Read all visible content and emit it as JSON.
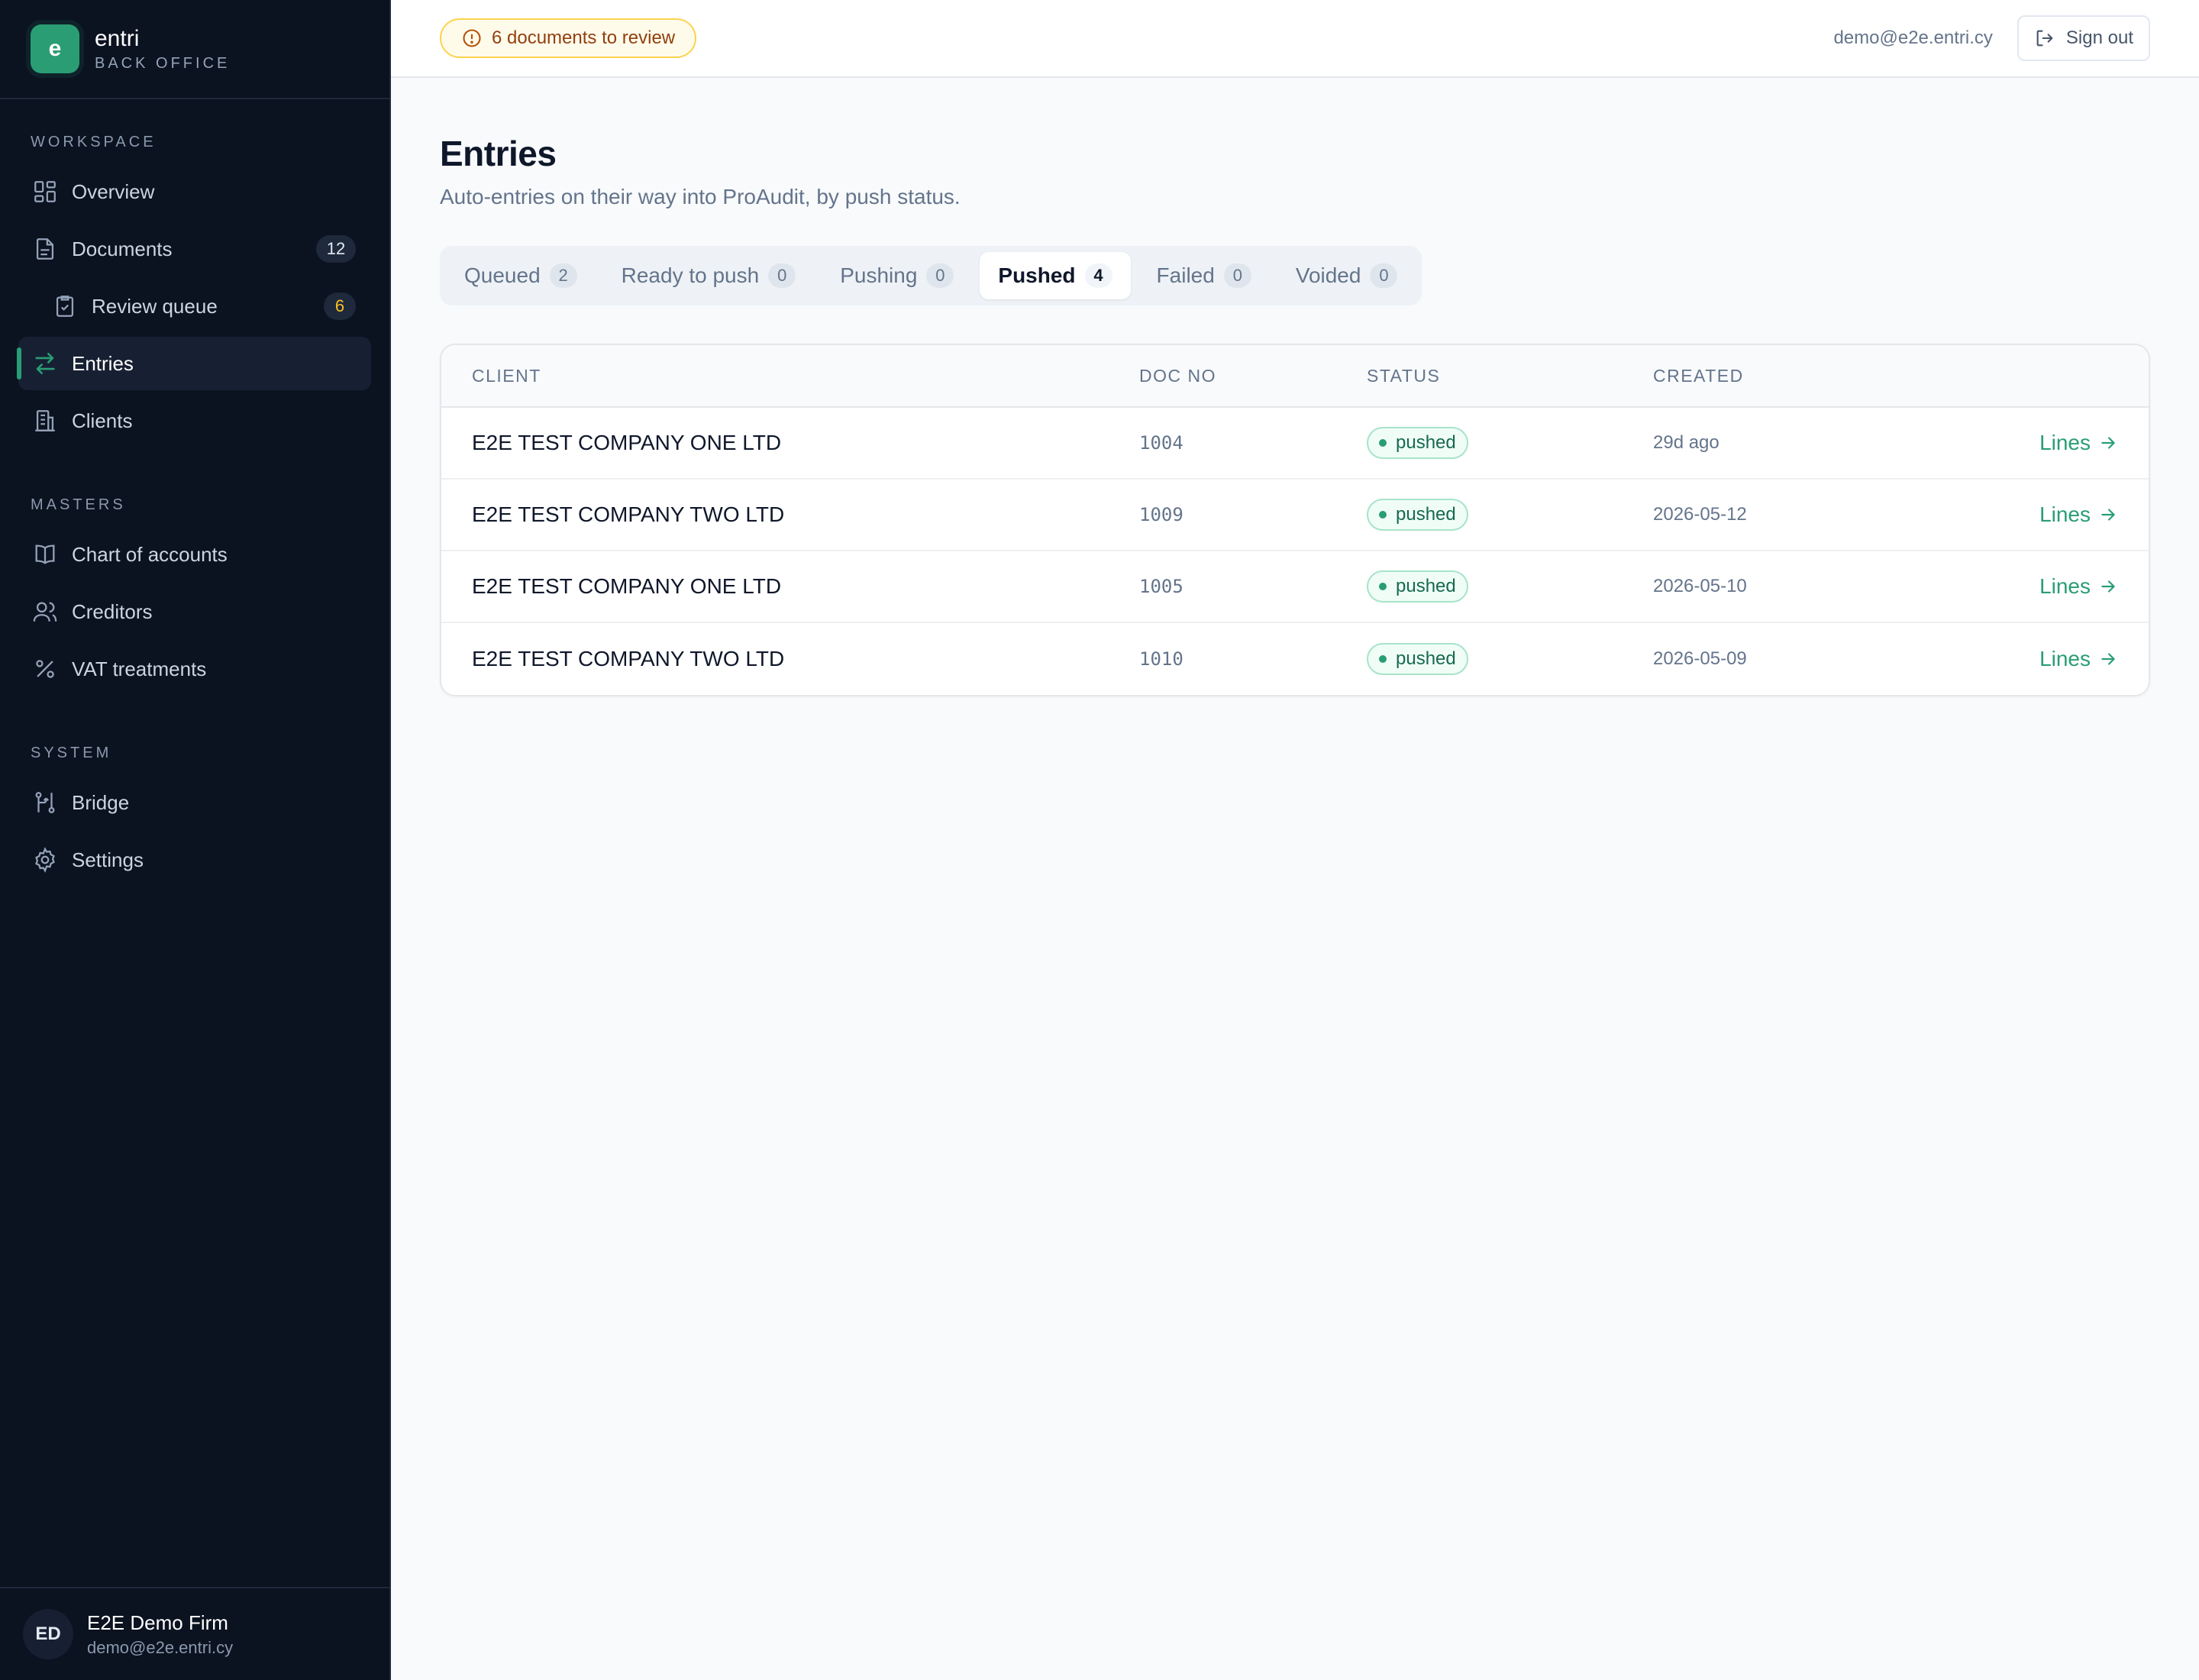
{
  "brand": {
    "logo_letter": "e",
    "name": "entri",
    "subtitle": "BACK OFFICE"
  },
  "sidebar": {
    "sections": [
      {
        "label": "WORKSPACE"
      },
      {
        "label": "MASTERS"
      },
      {
        "label": "SYSTEM"
      }
    ],
    "items": [
      {
        "label": "Overview",
        "icon": "grid-icon"
      },
      {
        "label": "Documents",
        "icon": "document-icon",
        "count": "12"
      },
      {
        "label": "Review queue",
        "icon": "clipboard-check-icon",
        "count": "6"
      },
      {
        "label": "Entries",
        "icon": "arrows-swap-icon",
        "active": true
      },
      {
        "label": "Clients",
        "icon": "building-icon"
      },
      {
        "label": "Chart of accounts",
        "icon": "book-icon"
      },
      {
        "label": "Creditors",
        "icon": "users-icon"
      },
      {
        "label": "VAT treatments",
        "icon": "percent-icon"
      },
      {
        "label": "Bridge",
        "icon": "bridge-icon"
      },
      {
        "label": "Settings",
        "icon": "gear-icon"
      }
    ],
    "footer": {
      "initials": "ED",
      "firm_name": "E2E Demo Firm",
      "email": "demo@e2e.entri.cy"
    }
  },
  "topbar": {
    "review_alert": "6 documents to review",
    "user_email": "demo@e2e.entri.cy",
    "signout_label": "Sign out"
  },
  "page": {
    "title": "Entries",
    "subtitle": "Auto-entries on their way into ProAudit, by push status."
  },
  "tabs": [
    {
      "label": "Queued",
      "count": "2"
    },
    {
      "label": "Ready to push",
      "count": "0"
    },
    {
      "label": "Pushing",
      "count": "0"
    },
    {
      "label": "Pushed",
      "count": "4",
      "active": true
    },
    {
      "label": "Failed",
      "count": "0"
    },
    {
      "label": "Voided",
      "count": "0"
    }
  ],
  "table": {
    "headers": {
      "client": "CLIENT",
      "doc_no": "DOC NO",
      "status": "STATUS",
      "created": "CREATED"
    },
    "rows": [
      {
        "client": "E2E TEST COMPANY ONE LTD",
        "doc_no": "1004",
        "status": "pushed",
        "created": "29d ago",
        "action": "Lines"
      },
      {
        "client": "E2E TEST COMPANY TWO LTD",
        "doc_no": "1009",
        "status": "pushed",
        "created": "2026-05-12",
        "action": "Lines"
      },
      {
        "client": "E2E TEST COMPANY ONE LTD",
        "doc_no": "1005",
        "status": "pushed",
        "created": "2026-05-10",
        "action": "Lines"
      },
      {
        "client": "E2E TEST COMPANY TWO LTD",
        "doc_no": "1010",
        "status": "pushed",
        "created": "2026-05-09",
        "action": "Lines"
      }
    ]
  },
  "colors": {
    "accent": "#2a9d74",
    "sidebar_bg": "#0b1220",
    "warning": "#fbbf24"
  }
}
